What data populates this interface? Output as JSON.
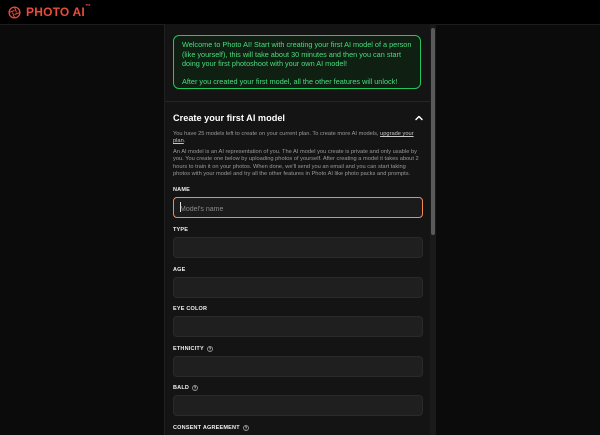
{
  "app": {
    "logo_text": "PHOTO AI",
    "logo_tm": "™",
    "brand_color": "#e74c3c"
  },
  "welcome": {
    "line1": "Welcome to Photo AI! Start with creating your first AI model of a person (like yourself), this will take about 30 minutes and then you can start doing your first photoshoot with your own AI model!",
    "line2": "After you created your first model, all the other features will unlock!",
    "accent_color": "#22c55e"
  },
  "section": {
    "title": "Create your first AI model",
    "collapse_icon": "chevron-up-icon",
    "intro_text": "You have 25 models left to create on your current plan. To create more AI models,",
    "upgrade_link": "upgrade your plan",
    "intro_end": ".",
    "description": "An AI model is an AI representation of you. The AI model you create is private and only usable by you. You create one below by uploading photos of yourself. After creating a model it takes about 2 hours to train it on your photos. When done, we'll send you an email and you can start taking photos with your model and try all the other features in Photo AI like photo packs and prompts."
  },
  "fields": {
    "name": {
      "label": "NAME",
      "placeholder": "Model's name",
      "value": ""
    },
    "type": {
      "label": "TYPE",
      "value": ""
    },
    "age": {
      "label": "AGE",
      "value": ""
    },
    "eye_color": {
      "label": "EYE COLOR",
      "value": ""
    },
    "ethnicity": {
      "label": "ETHNICITY",
      "value": "",
      "help_icon": "question-circle-icon"
    },
    "bald": {
      "label": "BALD",
      "value": "",
      "help_icon": "question-circle-icon"
    },
    "consent": {
      "label": "CONSENT AGREEMENT",
      "help_icon": "question-circle-icon"
    }
  },
  "colors": {
    "focus_border": "#f28b55"
  }
}
